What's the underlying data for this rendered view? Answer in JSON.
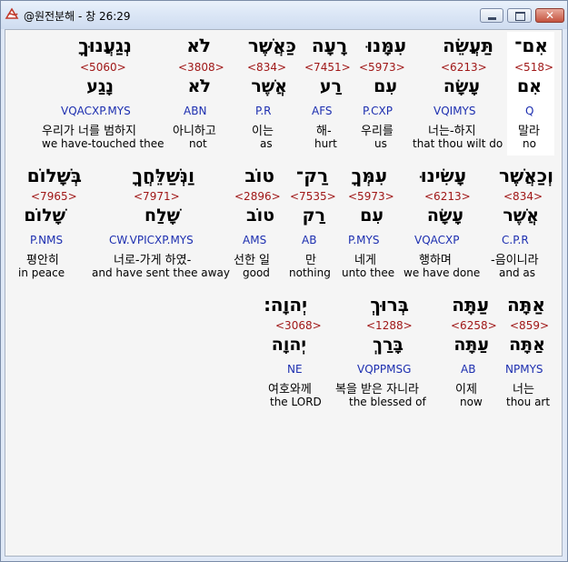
{
  "window": {
    "title": "@원전분해 - 창 26:29",
    "close_glyph": "✕"
  },
  "rows": [
    {
      "words": [
        {
          "top": "אִם־",
          "strong": "<518>",
          "lex": "אִם",
          "parse": "Q",
          "kor": "말라",
          "eng": "no"
        },
        {
          "top": "תַּעֲשֵׂה",
          "strong": "<6213>",
          "lex": "עָשָׂה",
          "parse": "VQIMYS",
          "kor": "너는-하지",
          "eng": "that thou wilt do"
        },
        {
          "top": "עִמָּנוּ",
          "strong": "<5973>",
          "lex": "עִם",
          "parse": "P.CXP",
          "kor": "우리를",
          "eng": "us"
        },
        {
          "top": "רָעָה",
          "strong": "<7451>",
          "lex": "רַע",
          "parse": "AFS",
          "kor": "해-",
          "eng": "hurt"
        },
        {
          "top": "כַּאֲשֶׁר",
          "strong": "<834>",
          "lex": "אֲשֶׁר",
          "parse": "P.R",
          "kor": "이는",
          "eng": "as"
        },
        {
          "top": "לֹא",
          "strong": "<3808>",
          "lex": "לֹא",
          "parse": "ABN",
          "kor": "아니하고",
          "eng": "not"
        },
        {
          "top": "נְגַעֲנוּךָ",
          "strong": "<5060>",
          "lex": "נָגַע",
          "parse": "VQACXP.MYS",
          "kor": "우리가 너를 범하지",
          "eng": "we have-touched thee"
        }
      ]
    },
    {
      "words": [
        {
          "top": "וְכַאֲשֶׁר",
          "strong": "<834>",
          "lex": "אֲשֶׁר",
          "parse": "C.P.R",
          "kor": "-음이니라",
          "eng": "and as"
        },
        {
          "top": "עָשִׂינוּ",
          "strong": "<6213>",
          "lex": "עָשָׂה",
          "parse": "VQACXP",
          "kor": "행하며",
          "eng": "we have done"
        },
        {
          "top": "עִמְּךָ",
          "strong": "<5973>",
          "lex": "עִם",
          "parse": "P.MYS",
          "kor": "네게",
          "eng": "unto thee"
        },
        {
          "top": "רַק־",
          "strong": "<7535>",
          "lex": "רַק",
          "parse": "AB",
          "kor": "만",
          "eng": "nothing"
        },
        {
          "top": "טוֹב",
          "strong": "<2896>",
          "lex": "טוֹב",
          "parse": "AMS",
          "kor": "선한 일",
          "eng": "good"
        },
        {
          "top": "וַנְּשַׁלֵּחֲךָ",
          "strong": "<7971>",
          "lex": "שָׁלַח",
          "parse": "CW.VPICXP.MYS",
          "kor": "너로-가게 하였-",
          "eng": "and have sent thee away"
        },
        {
          "top": "בְּשָׁלוֹם",
          "strong": "<7965>",
          "lex": "שָׁלוֹם",
          "parse": "P.NMS",
          "kor": "평안히",
          "eng": "in peace"
        }
      ]
    },
    {
      "words": [
        {
          "top": "אַתָּה",
          "strong": "<859>",
          "lex": "אַתָּה",
          "parse": "NPMYS",
          "kor": "너는",
          "eng": "thou art"
        },
        {
          "top": "עַתָּה",
          "strong": "<6258>",
          "lex": "עַתָּה",
          "parse": "AB",
          "kor": "이제",
          "eng": "now"
        },
        {
          "top": "בְּרוּךְ",
          "strong": "<1288>",
          "lex": "בָּרַךְ",
          "parse": "VQPPMSG",
          "kor": "복을 받은 자니라",
          "eng": "the blessed of"
        },
        {
          "top": "יְהוָה׃",
          "strong": "<3068>",
          "lex": "יְהוָה",
          "parse": "NE",
          "kor": "여호와께",
          "eng": "the LORD"
        }
      ]
    }
  ]
}
